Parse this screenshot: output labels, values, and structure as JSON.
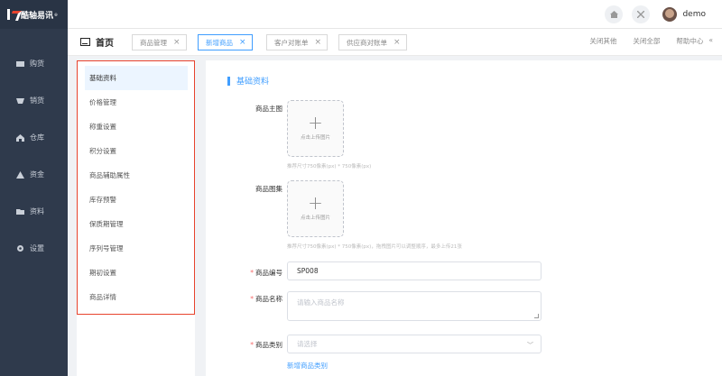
{
  "brand": {
    "name": "酷轴易讯",
    "reg": "®"
  },
  "sidebar": {
    "items": [
      {
        "label": "购货",
        "icon": "cart-icon"
      },
      {
        "label": "销货",
        "icon": "sell-icon"
      },
      {
        "label": "仓库",
        "icon": "warehouse-icon"
      },
      {
        "label": "资金",
        "icon": "money-icon"
      },
      {
        "label": "资料",
        "icon": "folder-icon"
      },
      {
        "label": "设置",
        "icon": "gear-icon"
      }
    ]
  },
  "topbar": {
    "user": "demo"
  },
  "tabs": {
    "home": "首页",
    "items": [
      {
        "label": "商品管理",
        "active": false
      },
      {
        "label": "新增商品",
        "active": true
      },
      {
        "label": "客户对账单",
        "active": false
      },
      {
        "label": "供应商对账单",
        "active": false
      }
    ],
    "actions": {
      "close_others": "关闭其他",
      "close_all": "关闭全部",
      "help": "帮助中心",
      "collapse": "«"
    }
  },
  "subnav": {
    "items": [
      "基础资料",
      "价格管理",
      "称重设置",
      "积分设置",
      "商品辅助属性",
      "库存预警",
      "保质期管理",
      "序列号管理",
      "期初设置",
      "商品详情"
    ],
    "active_index": 0
  },
  "form": {
    "section_title": "基础资料",
    "main_image": {
      "label": "商品主图",
      "upload_text": "点击上传图片",
      "hint": "推荐尺寸750像素(px) * 750像素(px)"
    },
    "gallery": {
      "label": "商品图集",
      "upload_text": "点击上传图片",
      "hint": "推荐尺寸750像素(px) * 750像素(px)，拖拽图片可以调整顺序，最多上传21张"
    },
    "code": {
      "label": "商品编号",
      "value": "SP008"
    },
    "name": {
      "label": "商品名称",
      "placeholder": "请输入商品名称"
    },
    "category": {
      "label": "商品类别",
      "placeholder": "请选择",
      "add_link": "新增商品类别"
    }
  },
  "colors": {
    "accent": "#409eff",
    "sidebar_bg": "#2f3a4c",
    "highlight_border": "#e8432d",
    "required": "#f56c6c"
  }
}
